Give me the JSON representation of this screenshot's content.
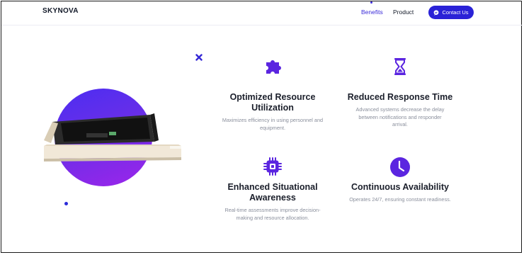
{
  "header": {
    "brand": "SKYNOVA",
    "nav": [
      {
        "label": "Benefits"
      },
      {
        "label": "Product"
      }
    ],
    "cta_label": "Contact Us"
  },
  "colors": {
    "accent": "#2a22d7",
    "brand_purple": "#6a2ee8",
    "text_dark": "#1b1f2b",
    "text_muted": "#8a8f9c"
  },
  "hero": {
    "image": "server-drawer-device"
  },
  "features": [
    {
      "icon": "puzzle-icon",
      "title_line1": "Optimized Resource",
      "title_line2": "Utilization",
      "desc_line1": "Maximizes efficiency in using personnel and",
      "desc_line2": "equipment."
    },
    {
      "icon": "hourglass-icon",
      "title_line1": "Reduced Response Time",
      "desc_line1": "Advanced systems decrease the delay",
      "desc_line2": "between notifications and responder",
      "desc_line3": "arrival."
    },
    {
      "icon": "chip-icon",
      "title_line1": "Enhanced Situational",
      "title_line2": "Awareness",
      "desc_line1": "Real-time assessments improve decision-",
      "desc_line2": "making and resource allocation."
    },
    {
      "icon": "clock-icon",
      "title_line1": "Continuous Availability",
      "desc_line1": "Operates 24/7, ensuring constant readiness."
    }
  ]
}
